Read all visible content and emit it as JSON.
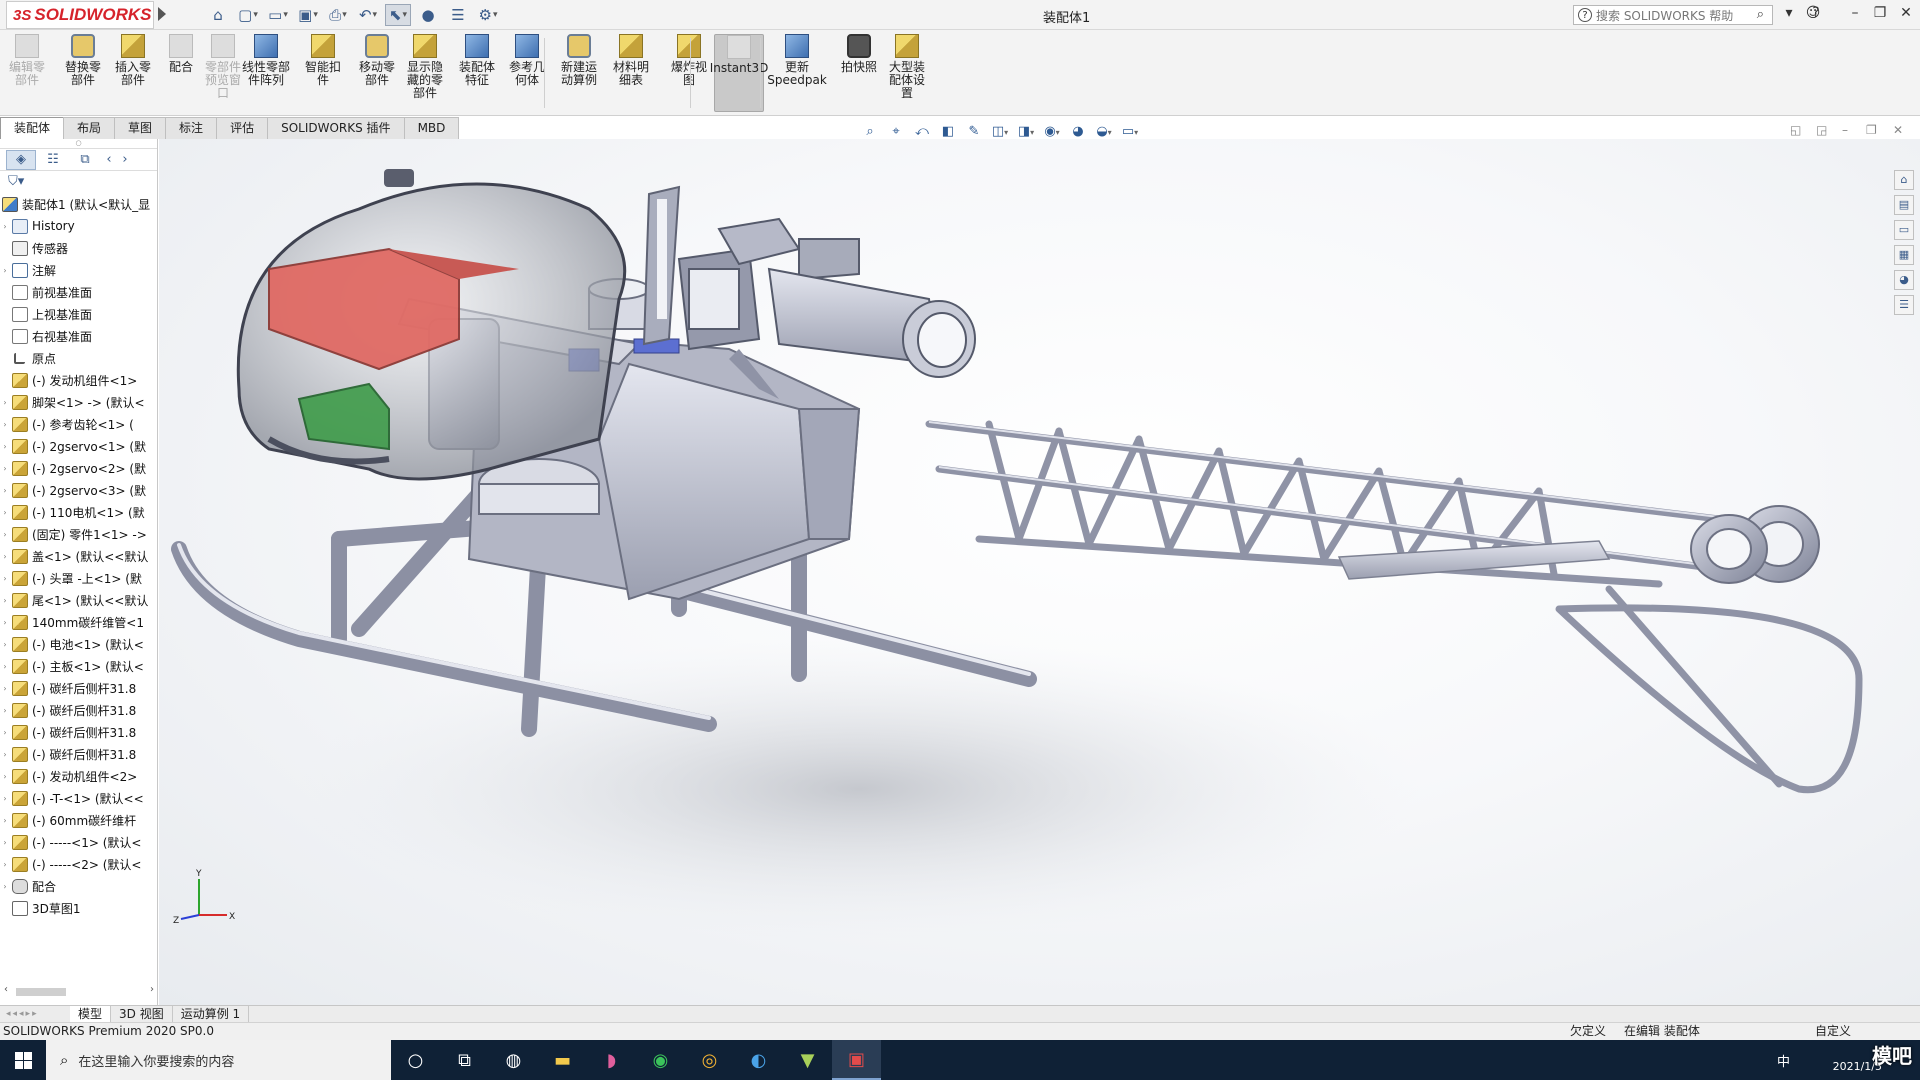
{
  "app": {
    "brand": "SOLIDWORKS",
    "brand_prefix": "3S",
    "window_title": "装配体1",
    "help_search_placeholder": "搜索 SOLIDWORKS 帮助",
    "accent": "#d6232b"
  },
  "ribbon": [
    {
      "label": "编辑零\n部件",
      "icon": "edit-component-icon",
      "disabled": true
    },
    {
      "label": "替换零\n部件",
      "icon": "replace-component-icon"
    },
    {
      "label": "插入零\n部件",
      "icon": "insert-component-icon"
    },
    {
      "label": "配合",
      "icon": "mate-icon"
    },
    {
      "label": "零部件\n预览窗\n口",
      "icon": "component-preview-icon",
      "disabled": true
    },
    {
      "label": "线性零部\n件阵列",
      "icon": "linear-pattern-icon"
    },
    {
      "label": "智能扣\n件",
      "icon": "smart-fasteners-icon"
    },
    {
      "label": "移动零\n部件",
      "icon": "move-component-icon"
    },
    {
      "label": "显示隐\n藏的零\n部件",
      "icon": "show-hidden-icon"
    },
    {
      "label": "装配体\n特征",
      "icon": "assembly-features-icon"
    },
    {
      "label": "参考几\n何体",
      "icon": "reference-geometry-icon"
    },
    {
      "label": "新建运\n动算例",
      "icon": "new-motion-study-icon"
    },
    {
      "label": "材料明\n细表",
      "icon": "bom-icon"
    },
    {
      "label": "爆炸视\n图",
      "icon": "exploded-view-icon"
    },
    {
      "label": "Instant3D",
      "icon": "instant3d-icon",
      "active": true
    },
    {
      "label": "更新\nSpeedpak",
      "icon": "speedpak-icon"
    },
    {
      "label": "拍快照",
      "icon": "snapshot-icon"
    },
    {
      "label": "大型装\n配体设\n置",
      "icon": "large-assembly-icon"
    }
  ],
  "tabs": [
    "装配体",
    "布局",
    "草图",
    "标注",
    "评估",
    "SOLIDWORKS 插件",
    "MBD"
  ],
  "feature_tree": {
    "root": "装配体1 (默认<默认_显",
    "items": [
      {
        "label": "History",
        "icon": "history-icon",
        "expand": true
      },
      {
        "label": "传感器",
        "icon": "sensor-icon"
      },
      {
        "label": "注解",
        "icon": "annotation-icon",
        "expand": true
      },
      {
        "label": "前视基准面",
        "icon": "plane-icon"
      },
      {
        "label": "上视基准面",
        "icon": "plane-icon"
      },
      {
        "label": "右视基准面",
        "icon": "plane-icon"
      },
      {
        "label": "原点",
        "icon": "origin-icon"
      },
      {
        "label": "(-) 发动机组件<1>",
        "icon": "subassembly-icon"
      },
      {
        "label": "脚架<1> -> (默认<",
        "icon": "part-icon",
        "expand": true
      },
      {
        "label": "(-) 参考齿轮<1> (",
        "icon": "part-icon",
        "expand": true
      },
      {
        "label": "(-) 2gservo<1> (默",
        "icon": "part-icon",
        "expand": true
      },
      {
        "label": "(-) 2gservo<2> (默",
        "icon": "part-icon",
        "expand": true
      },
      {
        "label": "(-) 2gservo<3> (默",
        "icon": "part-icon",
        "expand": true
      },
      {
        "label": "(-) 110电机<1> (默",
        "icon": "part-icon",
        "expand": true
      },
      {
        "label": "(固定) 零件1<1> ->",
        "icon": "part-icon",
        "expand": true
      },
      {
        "label": "盖<1> (默认<<默认",
        "icon": "part-icon",
        "expand": true
      },
      {
        "label": "(-) 头罩 -上<1> (默",
        "icon": "part-icon",
        "expand": true
      },
      {
        "label": "尾<1> (默认<<默认",
        "icon": "part-icon",
        "expand": true
      },
      {
        "label": "140mm碳纤维管<1",
        "icon": "part-icon",
        "expand": true
      },
      {
        "label": "(-) 电池<1> (默认<",
        "icon": "part-icon",
        "expand": true
      },
      {
        "label": "(-) 主板<1> (默认<",
        "icon": "part-icon",
        "expand": true
      },
      {
        "label": "(-) 碳纤后侧杆31.8",
        "icon": "part-icon",
        "expand": true
      },
      {
        "label": "(-) 碳纤后侧杆31.8",
        "icon": "part-icon",
        "expand": true
      },
      {
        "label": "(-) 碳纤后侧杆31.8",
        "icon": "part-icon",
        "expand": true
      },
      {
        "label": "(-) 碳纤后侧杆31.8",
        "icon": "part-icon",
        "expand": true
      },
      {
        "label": "(-) 发动机组件<2>",
        "icon": "subassembly-icon",
        "expand": true
      },
      {
        "label": "(-) -T-<1> (默认<<",
        "icon": "part-icon",
        "expand": true
      },
      {
        "label": "(-) 60mm碳纤维杆",
        "icon": "part-icon",
        "expand": true
      },
      {
        "label": "(-) -----<1> (默认<",
        "icon": "part-icon",
        "expand": true
      },
      {
        "label": "(-) -----<2> (默认<",
        "icon": "part-icon",
        "expand": true
      },
      {
        "label": "配合",
        "icon": "mates-icon",
        "expand": true
      },
      {
        "label": "3D草图1",
        "icon": "sketch3d-icon"
      }
    ]
  },
  "bottom_tabs": [
    "模型",
    "3D 视图",
    "运动算例 1"
  ],
  "status": {
    "left": "SOLIDWORKS Premium 2020 SP0.0",
    "state1": "欠定义",
    "state2": "在编辑 装配体",
    "state3": "自定义"
  },
  "taskbar": {
    "search_placeholder": "在这里输入你要搜索的内容",
    "ime": "中",
    "clock": "2021/1/5"
  },
  "axes": {
    "x": "X",
    "y": "Y",
    "z": "Z"
  },
  "watermark": "模吧"
}
